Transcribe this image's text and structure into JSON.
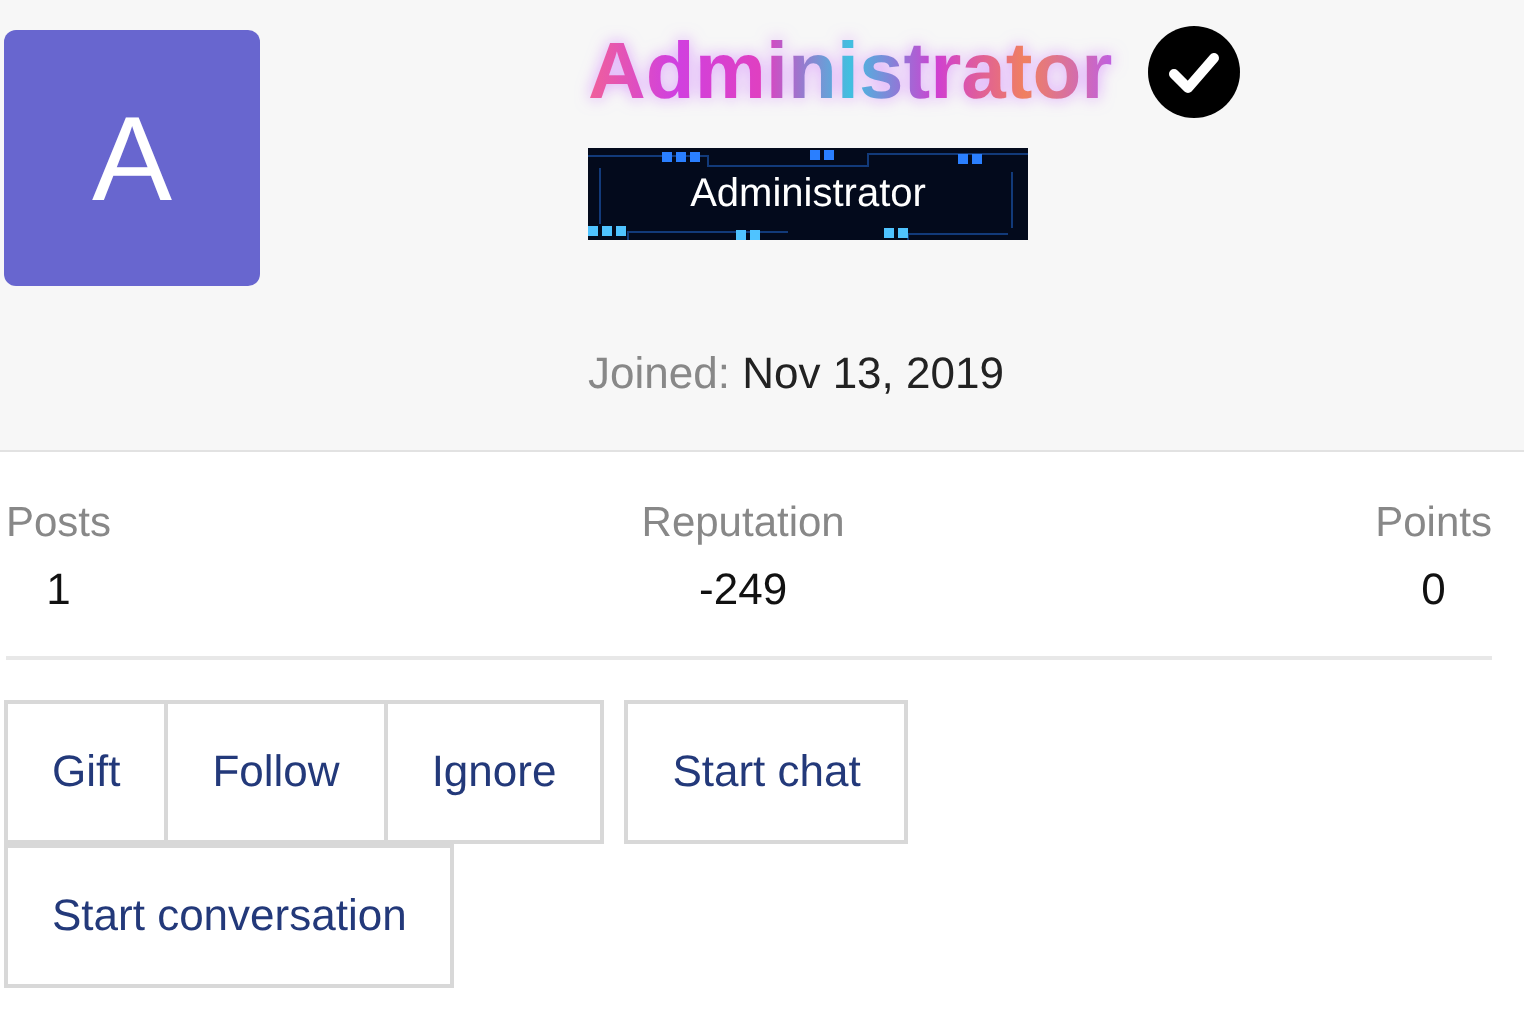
{
  "profile": {
    "avatar_letter": "A",
    "name": "Administrator",
    "verified": true,
    "role_banner": "Administrator",
    "joined_label": "Joined:",
    "joined_date": "Nov 13, 2019"
  },
  "stats": [
    {
      "label": "Posts",
      "value": "1"
    },
    {
      "label": "Reputation",
      "value": "-249"
    },
    {
      "label": "Points",
      "value": "0"
    }
  ],
  "button_groups": [
    [
      "Gift",
      "Follow",
      "Ignore"
    ],
    [
      "Start chat"
    ],
    [
      "Start conversation"
    ]
  ]
}
